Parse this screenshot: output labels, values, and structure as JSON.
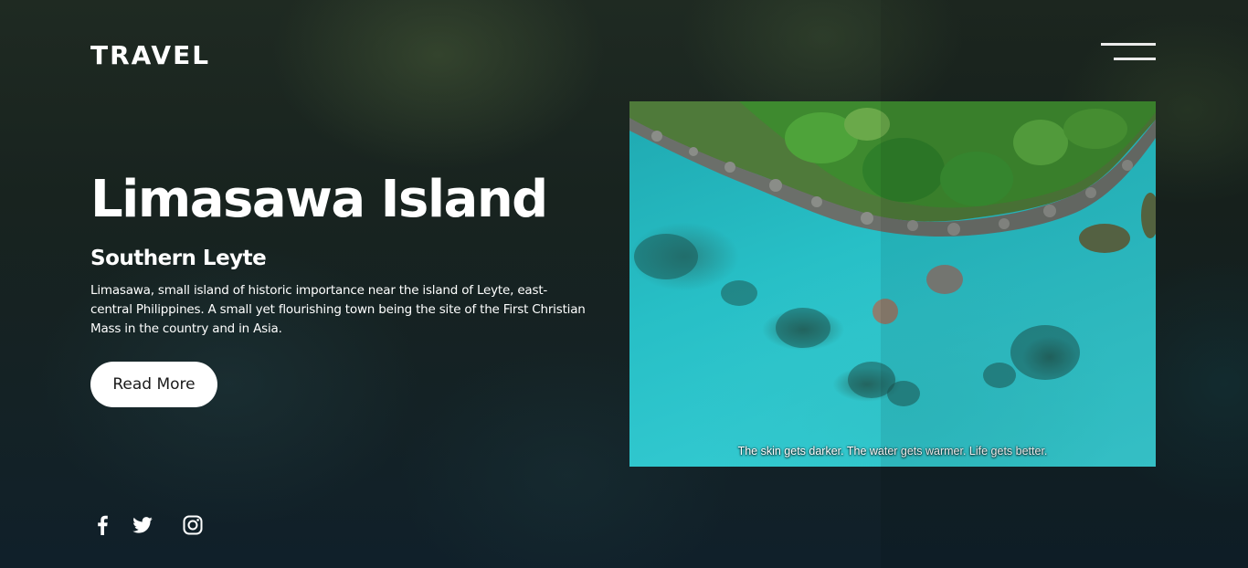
{
  "brand": {
    "logo_text": "TRAVEL"
  },
  "menu": {
    "icon": "hamburger-menu-icon"
  },
  "hero": {
    "title": "Limasawa Island",
    "subtitle": "Southern Leyte",
    "description": "Limasawa, small island of historic importance near the island of Leyte, east-central Philippines. A small yet flourishing town being the site of the First Christian Mass in the country and in Asia.",
    "cta_label": "Read More"
  },
  "video": {
    "caption": "The skin gets darker. The water gets warmer. Life gets better."
  },
  "socials": [
    {
      "icon": "facebook-icon"
    },
    {
      "icon": "twitter-icon"
    },
    {
      "icon": "instagram-icon"
    }
  ],
  "colors": {
    "text": "#ffffff",
    "button_bg": "#ffffff",
    "button_text": "#1a1a1a",
    "water": "#2fc3c8"
  }
}
